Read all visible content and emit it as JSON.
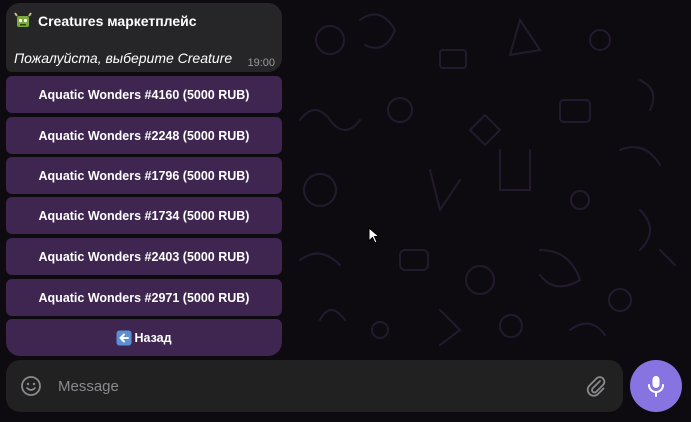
{
  "chat": {
    "bot_title": "Creatures маркетплейс",
    "message_text": "Пожалуйста, выберите Creature",
    "time": "19:00"
  },
  "keyboard": {
    "buttons": [
      {
        "label": "Aquatic Wonders #4160 (5000 RUB)"
      },
      {
        "label": "Aquatic Wonders #2248 (5000 RUB)"
      },
      {
        "label": "Aquatic Wonders #1796 (5000 RUB)"
      },
      {
        "label": "Aquatic Wonders #1734 (5000 RUB)"
      },
      {
        "label": "Aquatic Wonders #2403 (5000 RUB)"
      },
      {
        "label": "Aquatic Wonders #2971 (5000 RUB)"
      }
    ],
    "back_label": "Назад",
    "button_color": "#3e2650"
  },
  "composer": {
    "placeholder": "Message"
  },
  "icons": {
    "bot_emoji": "monster-icon",
    "back": "back-arrow-icon",
    "emoji": "smiley-icon",
    "attach": "paperclip-icon",
    "mic": "microphone-icon"
  },
  "colors": {
    "background": "#0d0b10",
    "bubble": "#262628",
    "accent": "#8774e1",
    "composer": "#212121"
  }
}
